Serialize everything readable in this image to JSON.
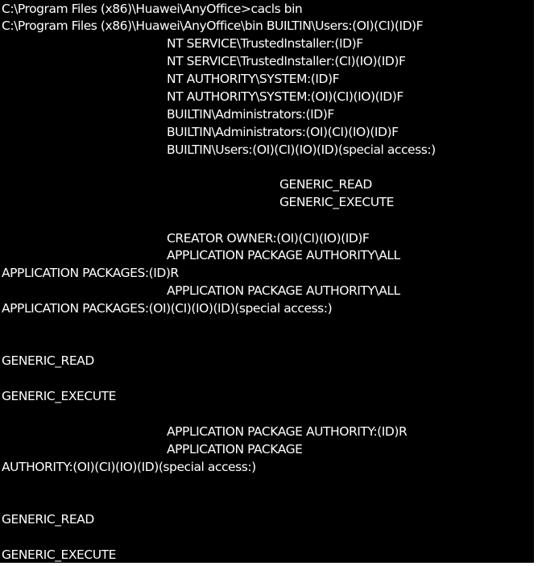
{
  "terminal": {
    "background": "#000000",
    "foreground": "#ffffff",
    "lines": [
      "C:\\Program Files (x86)\\Huawei\\AnyOffice>cacls bin",
      "C:\\Program Files (x86)\\Huawei\\AnyOffice\\bin BUILTIN\\Users:(OI)(CI)(ID)F",
      "NT SERVICE\\TrustedInstaller:(ID)F",
      "NT SERVICE\\TrustedInstaller:(CI)(IO)(ID)F",
      "NT AUTHORITY\\SYSTEM:(ID)F",
      "NT AUTHORITY\\SYSTEM:(OI)(CI)(IO)(ID)F",
      "BUILTIN\\Administrators:(ID)F",
      "BUILTIN\\Administrators:(OI)(CI)(IO)(ID)F",
      "BUILTIN\\Users:(OI)(CI)(IO)(ID)(special access:)",
      "GENERIC_READ",
      "GENERIC_EXECUTE",
      "CREATOR OWNER:(OI)(CI)(IO)(ID)F",
      "APPLICATION PACKAGE AUTHORITY\\ALL",
      "APPLICATION PACKAGES:(ID)R",
      "APPLICATION PACKAGE AUTHORITY\\ALL",
      "APPLICATION PACKAGES:(OI)(CI)(IO)(ID)(special access:)",
      "GENERIC_READ",
      "GENERIC_EXECUTE",
      "APPLICATION PACKAGE AUTHORITY:(ID)R",
      "APPLICATION PACKAGE",
      "AUTHORITY:(OI)(CI)(IO)(ID)(special access:)",
      "GENERIC_READ",
      "GENERIC_EXECUTE"
    ]
  }
}
